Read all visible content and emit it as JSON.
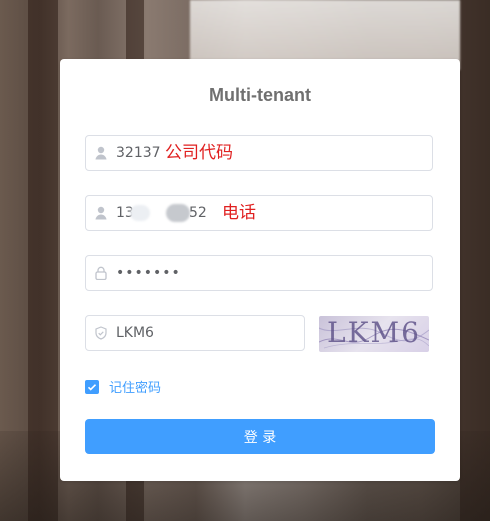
{
  "title": "Multi-tenant",
  "fields": {
    "company": {
      "value": "32137",
      "note": "公司代码"
    },
    "phone": {
      "value_prefix": "13",
      "value_suffix": "52",
      "note": "电话"
    },
    "password": {
      "value": "•••••••"
    },
    "captcha": {
      "value": "LKM6",
      "image_text": "LKM6"
    }
  },
  "remember": {
    "label": "记住密码",
    "checked": true
  },
  "login_button": {
    "label": "登 录"
  },
  "colors": {
    "accent": "#409eff",
    "note": "#e02020",
    "title": "#707070"
  },
  "icons": {
    "user": "user-icon",
    "lock": "lock-icon",
    "shield": "shield-icon",
    "check": "check-icon"
  }
}
